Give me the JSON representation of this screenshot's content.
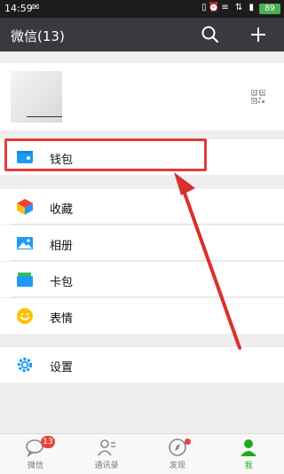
{
  "status_bar": {
    "time": "14:59",
    "battery": "89"
  },
  "header": {
    "title": "微信(13)"
  },
  "menu": {
    "wallet": "钱包",
    "favorites": "收藏",
    "album": "相册",
    "cards": "卡包",
    "stickers": "表情",
    "settings": "设置"
  },
  "tabbar": {
    "tabs": [
      {
        "label": "微信",
        "badge": "13"
      },
      {
        "label": "通讯录"
      },
      {
        "label": "发现"
      },
      {
        "label": "我"
      }
    ]
  },
  "colors": {
    "header_bg": "#393a3f",
    "accent_green": "#1aad19",
    "highlight_red": "#e23b3b"
  }
}
